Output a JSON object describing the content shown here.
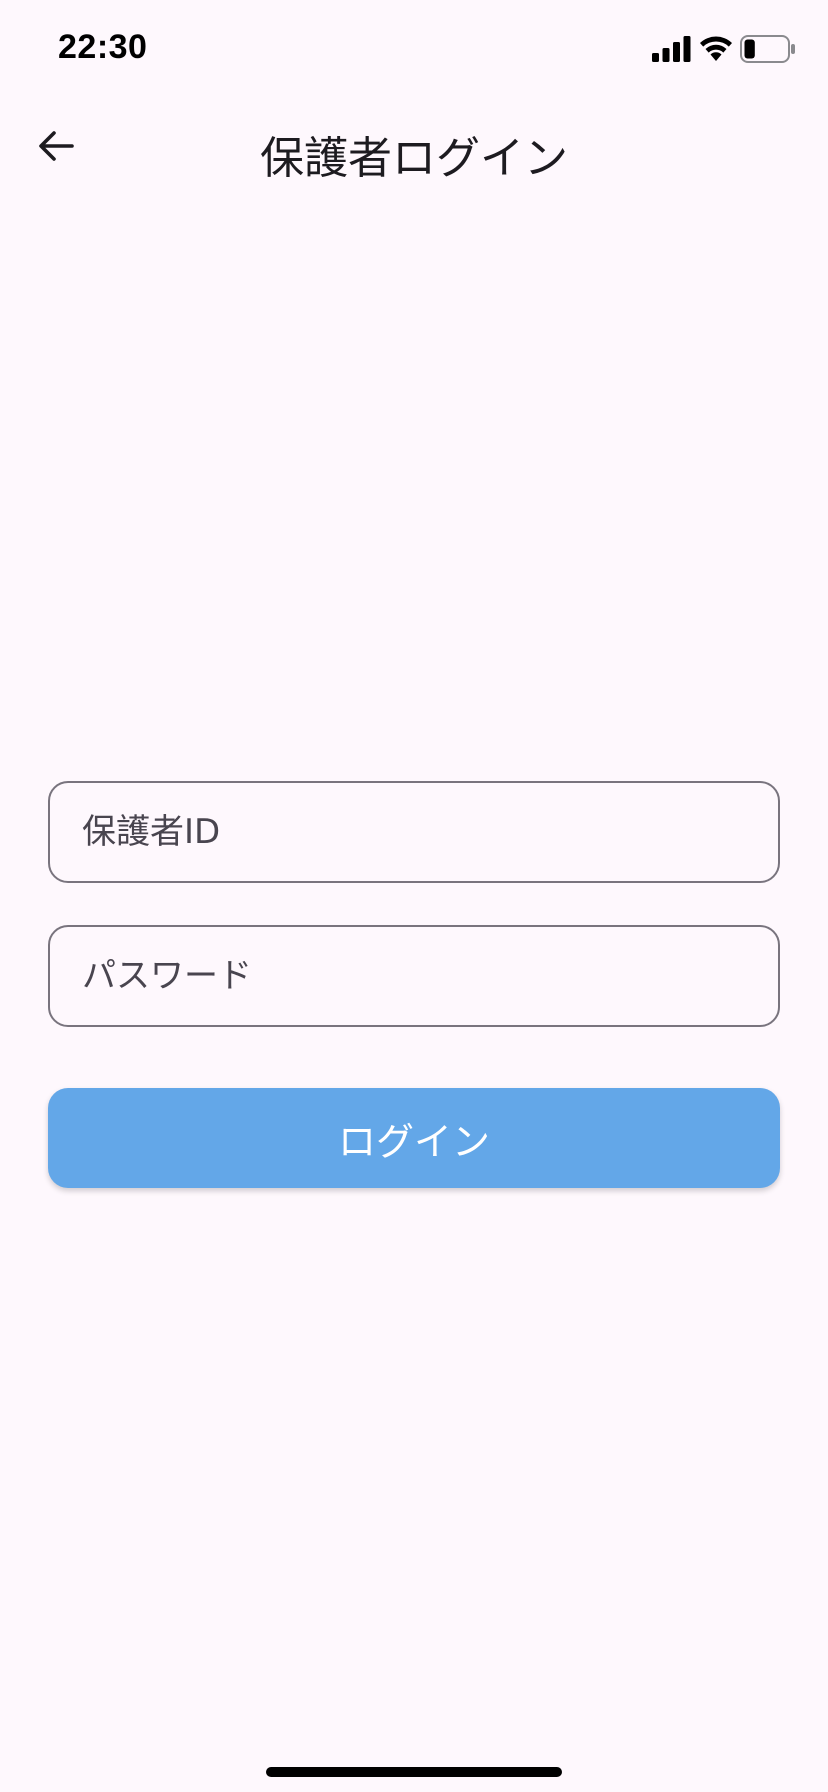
{
  "status_bar": {
    "time": "22:30",
    "signal_icon": "cellular-signal-icon",
    "wifi_icon": "wifi-icon",
    "battery_icon": "battery-icon",
    "battery_level": 0.25
  },
  "app_bar": {
    "back_icon": "arrow-left-icon",
    "title": "保護者ログイン"
  },
  "form": {
    "guardian_id": {
      "value": "",
      "placeholder": "保護者ID"
    },
    "password": {
      "value": "",
      "placeholder": "パスワード"
    },
    "login_label": "ログイン"
  },
  "colors": {
    "background": "#fef8fd",
    "primary_button": "#63a7e8",
    "field_border": "#79747e"
  }
}
